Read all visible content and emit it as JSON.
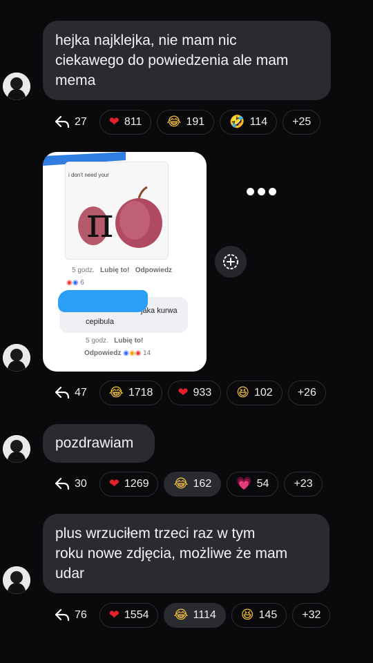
{
  "messages": [
    {
      "text_lines": [
        "hejka najklejka, nie mam nic",
        "ciekawego do powiedzenia ale mam",
        "mema"
      ],
      "replies": "27",
      "reactions": [
        {
          "emoji": "❤",
          "icon": "red-heart",
          "count": "811"
        },
        {
          "emoji": "😂",
          "icon": "tears-of-joy",
          "count": "191"
        },
        {
          "emoji": "🤣",
          "icon": "rolling-laughing",
          "count": "114"
        }
      ],
      "more": "+25"
    },
    {
      "meme": {
        "caption": "i don't need your",
        "pi": "π",
        "post_meta": {
          "time": "5 godz.",
          "like": "Lubię to!",
          "reply": "Odpowiedz",
          "reacts": "6"
        },
        "comment": {
          "text1": "jaka kurwa",
          "text2": "cepibula"
        },
        "comment_meta": {
          "time": "5 godz.",
          "like": "Lubię to!",
          "reply": "Odpowiedz",
          "reacts": "14"
        }
      },
      "replies": "47",
      "reactions": [
        {
          "emoji": "😂",
          "icon": "tears-of-joy",
          "count": "1718"
        },
        {
          "emoji": "❤",
          "icon": "red-heart",
          "count": "933"
        },
        {
          "emoji": "😆",
          "icon": "grinning-squint",
          "count": "102"
        }
      ],
      "more": "+26"
    },
    {
      "text_lines": [
        "pozdrawiam"
      ],
      "replies": "30",
      "reactions": [
        {
          "emoji": "❤",
          "icon": "red-heart",
          "count": "1269"
        },
        {
          "emoji": "😂",
          "icon": "tears-of-joy",
          "count": "162"
        },
        {
          "emoji": "💗",
          "icon": "pink-heart",
          "count": "54"
        }
      ],
      "more": "+23"
    },
    {
      "text_lines": [
        "plus wrzuciłem trzeci raz w tym",
        "roku nowe zdjęcia, możliwe że mam",
        "udar"
      ],
      "replies": "76",
      "reactions": [
        {
          "emoji": "❤",
          "icon": "red-heart",
          "count": "1554"
        },
        {
          "emoji": "😂",
          "icon": "tears-of-joy",
          "count": "1114"
        },
        {
          "emoji": "😆",
          "icon": "grinning-squint",
          "count": "145"
        }
      ],
      "more": "+32"
    }
  ],
  "colors": {
    "background": "#0a0a0c",
    "bubble": "#2a2a31",
    "heart": "#e8202a"
  }
}
